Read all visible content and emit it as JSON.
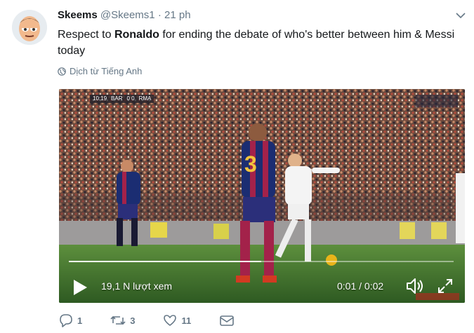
{
  "tweet": {
    "author_name": "Skeems",
    "author_handle": "@Skeems1",
    "separator": "·",
    "time": "21 ph",
    "text_before": "Respect to ",
    "text_bold": "Ronaldo",
    "text_after": " for ending the debate of who's better between him & Messi today",
    "translate_label": "Dịch từ Tiếng Anh"
  },
  "video": {
    "views": "19,1 N lượt xem",
    "timecode": "0:01 / 0:02",
    "progress_fraction": 0.5
  },
  "actions": {
    "reply_count": "1",
    "retweet_count": "3",
    "like_count": "11"
  },
  "colors": {
    "text": "#14171a",
    "muted": "#657786",
    "pitch": "#3f6f2c"
  },
  "icons": [
    "avatar-emoji",
    "chevron-down-icon",
    "globe-icon",
    "play-icon",
    "volume-icon",
    "fullscreen-icon",
    "reply-icon",
    "retweet-icon",
    "like-icon",
    "dm-icon"
  ]
}
